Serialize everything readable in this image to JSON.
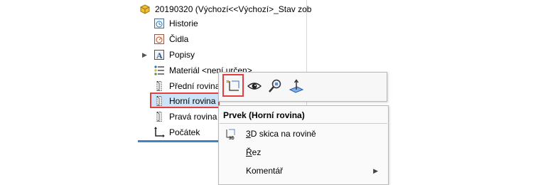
{
  "tree": {
    "root": {
      "label": "20190320  (Výchozí<<Výchozí>_Stav zob"
    },
    "items": [
      {
        "label": "Historie"
      },
      {
        "label": "Čidla"
      },
      {
        "label": "Popisy",
        "expandable": true
      },
      {
        "label": "Materiál <není určen>"
      },
      {
        "label": "Přední rovina"
      },
      {
        "label": "Horní rovina",
        "selected": true
      },
      {
        "label": "Pravá rovina"
      },
      {
        "label": "Počátek"
      }
    ]
  },
  "toolbar": {
    "buttons": [
      {
        "icon": "sketch-icon",
        "highlighted": true
      },
      {
        "icon": "eye-icon"
      },
      {
        "icon": "zoom-to-selection-icon"
      },
      {
        "icon": "normal-to-icon"
      }
    ]
  },
  "context_menu": {
    "title": "Prvek (Horní rovina)",
    "items": [
      {
        "label_pre": "",
        "label_key": "3",
        "label_post": "D skica na rovině",
        "icon": "3d-sketch-on-plane-icon"
      },
      {
        "label_pre": "",
        "label_key": "Ř",
        "label_post": "ez",
        "icon": ""
      },
      {
        "label_pre": "Komentář",
        "label_key": "",
        "label_post": "",
        "icon": "",
        "submenu": true
      }
    ]
  },
  "colors": {
    "highlight_border": "#e04040",
    "selection": "#cde3f7",
    "accent": "#3a86c8"
  }
}
